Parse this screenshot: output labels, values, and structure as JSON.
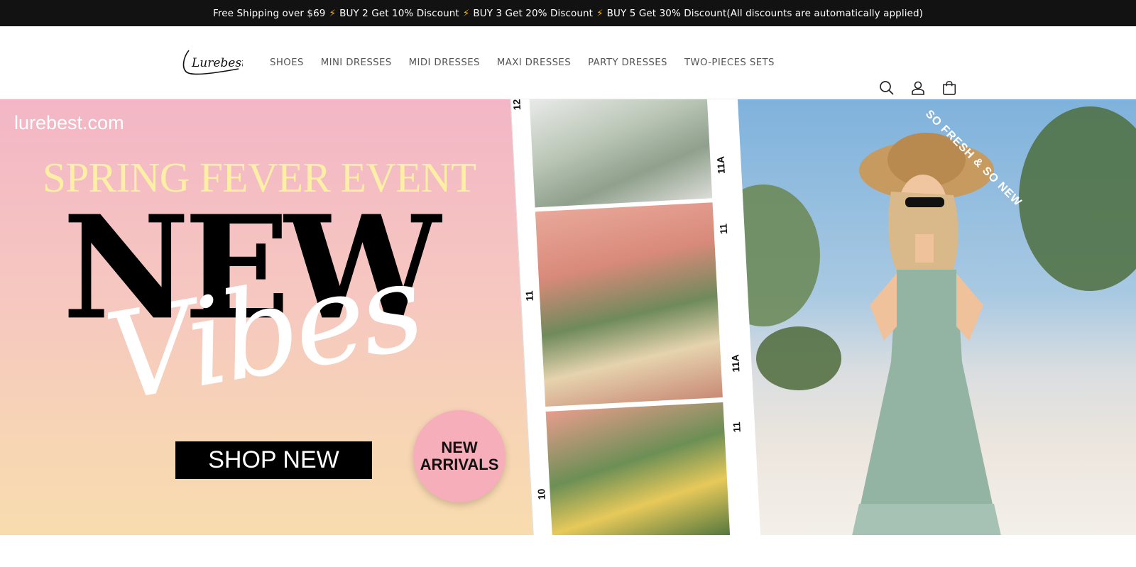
{
  "announcement": {
    "part1": "Free Shipping over $69",
    "part2": "BUY 2 Get 10% Discount",
    "part3": "BUY 3 Get 20% Discount",
    "part4": "BUY 5 Get 30% Discount(All discounts are automatically applied)",
    "bolt": "⚡"
  },
  "header": {
    "logo_text": "Lurebest",
    "nav": [
      "SHOES",
      "MINI DRESSES",
      "MIDI DRESSES",
      "MAXI DRESSES",
      "PARTY DRESSES",
      "TWO-PIECES SETS"
    ],
    "icons": [
      "search-icon",
      "account-icon",
      "cart-icon"
    ]
  },
  "hero": {
    "site_url": "lurebest.com",
    "event_title": "SPRING FEVER EVENT",
    "headline": "NEW",
    "script_word": "Vibes",
    "cta": "SHOP NEW",
    "badge_line1": "NEW",
    "badge_line2": "ARRIVALS",
    "tagline": "SO FRESH & SO NEW",
    "film_frames": [
      "12",
      "11A",
      "11",
      "11",
      "11A",
      "10",
      "11"
    ]
  },
  "colors": {
    "announcement_bg": "#121212",
    "bolt": "#f5b400",
    "event_title": "#fdf0a6",
    "badge": "#f6aeba"
  }
}
